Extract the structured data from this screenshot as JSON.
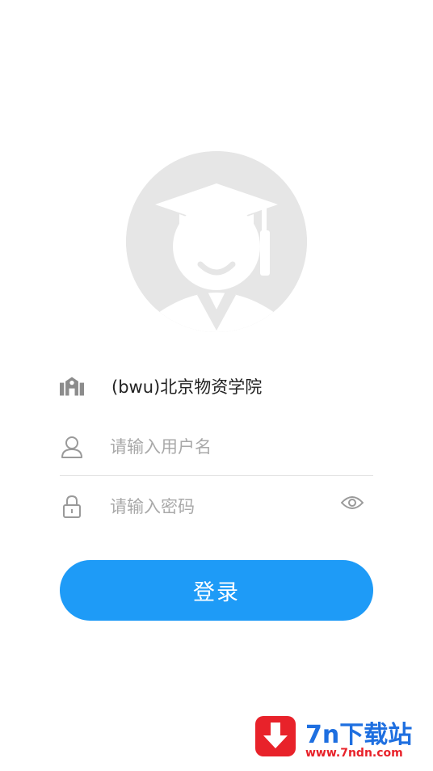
{
  "avatar": {
    "icon": "graduate-avatar-icon"
  },
  "school": {
    "icon": "school-building-icon",
    "name": "(bwu)北京物资学院"
  },
  "username": {
    "icon": "user-icon",
    "placeholder": "请输入用户名",
    "value": ""
  },
  "password": {
    "icon": "lock-icon",
    "placeholder": "请输入密码",
    "value": "",
    "toggle_icon": "eye-icon"
  },
  "login": {
    "label": "登录",
    "color": "#1e9bf7"
  },
  "watermark": {
    "title": "7n下载站",
    "url": "www.7ndn.com",
    "icon": "download-arrow-icon"
  }
}
